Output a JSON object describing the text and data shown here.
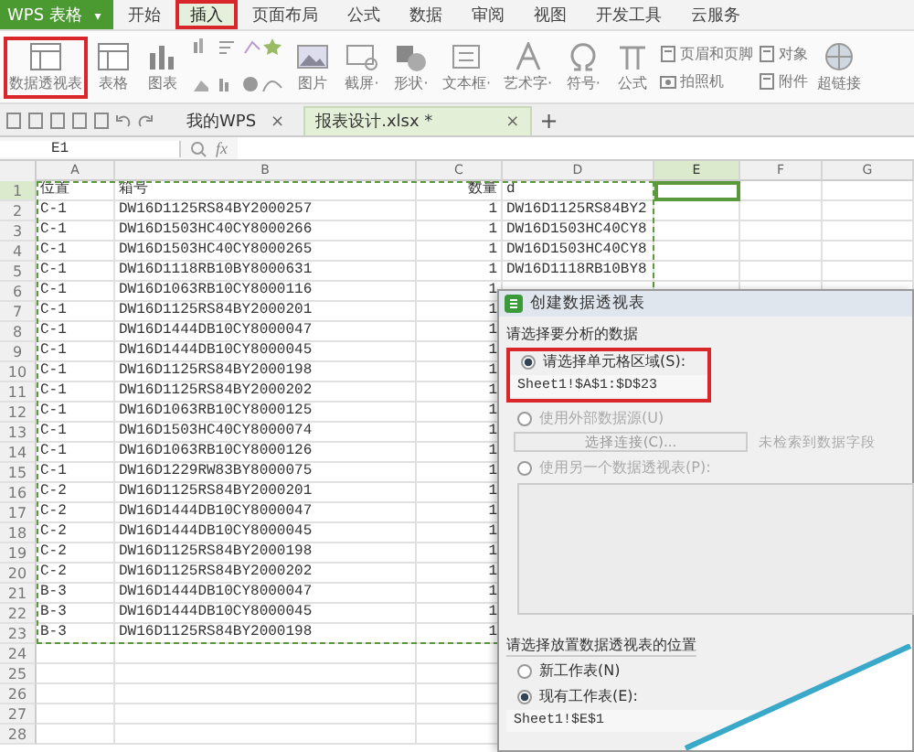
{
  "app_menu": {
    "label": "WPS 表格",
    "caret": "▾"
  },
  "menu_tabs": [
    {
      "label": "开始",
      "selected": false,
      "marked": false
    },
    {
      "label": "插入",
      "selected": true,
      "marked": true
    },
    {
      "label": "页面布局",
      "selected": false,
      "marked": false
    },
    {
      "label": "公式",
      "selected": false,
      "marked": false
    },
    {
      "label": "数据",
      "selected": false,
      "marked": false
    },
    {
      "label": "审阅",
      "selected": false,
      "marked": false
    },
    {
      "label": "视图",
      "selected": false,
      "marked": false
    },
    {
      "label": "开发工具",
      "selected": false,
      "marked": false
    },
    {
      "label": "云服务",
      "selected": false,
      "marked": false
    }
  ],
  "ribbon": [
    {
      "kind": "large",
      "label": "数据透视表",
      "marked": true
    },
    {
      "kind": "large",
      "label": "表格",
      "marked": false
    },
    {
      "kind": "large",
      "label": "图表",
      "marked": false
    },
    {
      "kind": "charts"
    },
    {
      "kind": "large",
      "label": "图片",
      "marked": false
    },
    {
      "kind": "large",
      "label": "截屏·",
      "marked": false
    },
    {
      "kind": "large",
      "label": "形状·",
      "marked": false
    },
    {
      "kind": "large",
      "label": "文本框·",
      "marked": false
    },
    {
      "kind": "large",
      "label": "艺术字·",
      "marked": false
    },
    {
      "kind": "large",
      "label": "符号·",
      "marked": false
    },
    {
      "kind": "large",
      "label": "公式",
      "marked": false
    },
    {
      "kind": "small",
      "items": [
        "页眉和页脚",
        "拍照机"
      ]
    },
    {
      "kind": "small",
      "items": [
        "对象",
        "附件"
      ]
    },
    {
      "kind": "large",
      "label": "超链接",
      "marked": false
    }
  ],
  "doc_tabs": [
    {
      "label": "我的WPS",
      "selected": false,
      "close": "×"
    },
    {
      "label": "报表设计.xlsx *",
      "selected": true,
      "close": "×"
    }
  ],
  "new_tab": "+",
  "formula_bar": {
    "name_box": "E1",
    "fx": "fx"
  },
  "sheet": {
    "columns": [
      {
        "label": "A",
        "selected": false
      },
      {
        "label": "B",
        "selected": false
      },
      {
        "label": "C",
        "selected": false
      },
      {
        "label": "D",
        "selected": false
      },
      {
        "label": "E",
        "selected": true
      },
      {
        "label": "F",
        "selected": false
      },
      {
        "label": "G",
        "selected": false
      }
    ],
    "rows": [
      {
        "num": "1",
        "cells": [
          "位置",
          "箱号",
          "数量",
          "d"
        ]
      },
      {
        "num": "2",
        "cells": [
          "C-1",
          "DW16D1125RS84BY2000257",
          "1",
          "DW16D1125RS84BY2"
        ]
      },
      {
        "num": "3",
        "cells": [
          "C-1",
          "DW16D1503HC40CY8000266",
          "1",
          "DW16D1503HC40CY8"
        ]
      },
      {
        "num": "4",
        "cells": [
          "C-1",
          "DW16D1503HC40CY8000265",
          "1",
          "DW16D1503HC40CY8"
        ]
      },
      {
        "num": "5",
        "cells": [
          "C-1",
          "DW16D1118RB10BY8000631",
          "1",
          "DW16D1118RB10BY8"
        ]
      },
      {
        "num": "6",
        "cells": [
          "C-1",
          "DW16D1063RB10CY8000116",
          "1"
        ]
      },
      {
        "num": "7",
        "cells": [
          "C-1",
          "DW16D1125RS84BY2000201",
          "1"
        ]
      },
      {
        "num": "8",
        "cells": [
          "C-1",
          "DW16D1444DB10CY8000047",
          "1"
        ]
      },
      {
        "num": "9",
        "cells": [
          "C-1",
          "DW16D1444DB10CY8000045",
          "1"
        ]
      },
      {
        "num": "10",
        "cells": [
          "C-1",
          "DW16D1125RS84BY2000198",
          "1"
        ]
      },
      {
        "num": "11",
        "cells": [
          "C-1",
          "DW16D1125RS84BY2000202",
          "1"
        ]
      },
      {
        "num": "12",
        "cells": [
          "C-1",
          "DW16D1063RB10CY8000125",
          "1"
        ]
      },
      {
        "num": "13",
        "cells": [
          "C-1",
          "DW16D1503HC40CY8000074",
          "1"
        ]
      },
      {
        "num": "14",
        "cells": [
          "C-1",
          "DW16D1063RB10CY8000126",
          "1"
        ]
      },
      {
        "num": "15",
        "cells": [
          "C-1",
          "DW16D1229RW83BY8000075",
          "1"
        ]
      },
      {
        "num": "16",
        "cells": [
          "C-2",
          "DW16D1125RS84BY2000201",
          "1"
        ]
      },
      {
        "num": "17",
        "cells": [
          "C-2",
          "DW16D1444DB10CY8000047",
          "1"
        ]
      },
      {
        "num": "18",
        "cells": [
          "C-2",
          "DW16D1444DB10CY8000045",
          "1"
        ]
      },
      {
        "num": "19",
        "cells": [
          "C-2",
          "DW16D1125RS84BY2000198",
          "1"
        ]
      },
      {
        "num": "20",
        "cells": [
          "C-2",
          "DW16D1125RS84BY2000202",
          "1"
        ]
      },
      {
        "num": "21",
        "cells": [
          "B-3",
          "DW16D1444DB10CY8000047",
          "1"
        ]
      },
      {
        "num": "22",
        "cells": [
          "B-3",
          "DW16D1444DB10CY8000045",
          "1"
        ]
      },
      {
        "num": "23",
        "cells": [
          "B-3",
          "DW16D1125RS84BY2000198",
          "1"
        ]
      },
      {
        "num": "24",
        "cells": []
      },
      {
        "num": "25",
        "cells": []
      },
      {
        "num": "26",
        "cells": []
      },
      {
        "num": "27",
        "cells": []
      },
      {
        "num": "28",
        "cells": []
      }
    ]
  },
  "dialog": {
    "title": "创建数据透视表",
    "source_heading": "请选择要分析的数据",
    "source_options": [
      {
        "kind": "field",
        "label": "请选择单元格区域(S):",
        "selected": true,
        "disabled": false,
        "marked": true,
        "field": "Sheet1!$A$1:$D$23"
      },
      {
        "kind": "connection",
        "label": "使用外部数据源(U)",
        "selected": false,
        "disabled": true,
        "marked": false,
        "button": "选择连接(C)...",
        "note": "未检索到数据字段"
      },
      {
        "kind": "list",
        "label": "使用另一个数据透视表(P):",
        "selected": false,
        "disabled": true,
        "marked": false
      }
    ],
    "target_heading": "请选择放置数据透视表的位置",
    "target_options": [
      {
        "label": "新工作表(N)",
        "selected": false
      },
      {
        "label": "现有工作表(E):",
        "selected": true,
        "field": "Sheet1!$E$1"
      }
    ]
  }
}
